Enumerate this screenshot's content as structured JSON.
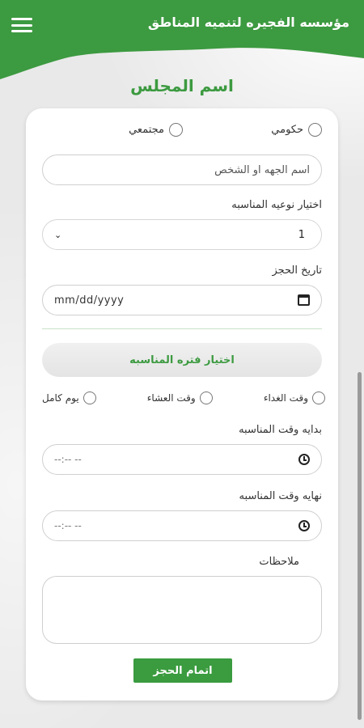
{
  "header": {
    "title": "مؤسسه الفجيره لتنميه المناطق",
    "menu_icon": "hamburger-menu-icon",
    "color": "#3c9a40"
  },
  "page_title": "اسم المجلس",
  "form": {
    "entity_type_options": [
      {
        "label": "حكومي",
        "selected": false
      },
      {
        "label": "مجتمعي",
        "selected": false
      }
    ],
    "entity_name_placeholder": "اسم الجهه او الشخص",
    "event_type_label": "اختيار نوعيه المناسبه",
    "event_type_value": "1",
    "booking_date_label": "تاريخ الحجز",
    "booking_date_placeholder": "mm/dd/yyyy",
    "period_button_label": "اختيار فتره المناسبه",
    "period_options": [
      {
        "label": "وقت الغداء",
        "selected": false
      },
      {
        "label": "وقت العشاء",
        "selected": false
      },
      {
        "label": "يوم كامل",
        "selected": false
      }
    ],
    "start_time_label": "بدايه وقت المناسبه",
    "start_time_placeholder": "--:-- --",
    "end_time_label": "نهايه وقت المناسبه",
    "end_time_placeholder": "--:-- --",
    "notes_label": "ملاحظات",
    "notes_value": "",
    "submit_label": "اتمام الحجز",
    "accent_color": "#3a9b3f"
  }
}
